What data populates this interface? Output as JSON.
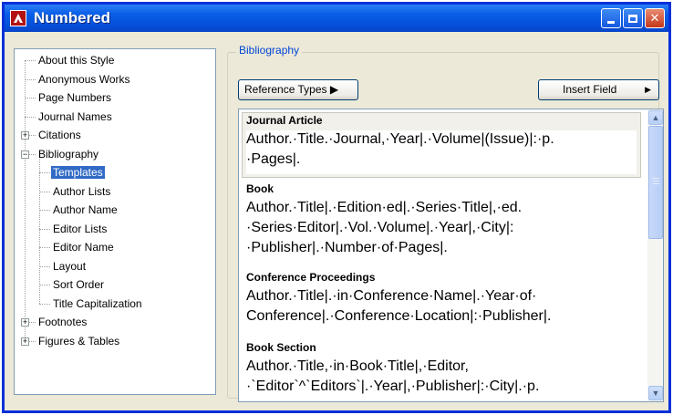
{
  "window": {
    "title": "Numbered"
  },
  "tree": {
    "items": [
      {
        "label": "About this Style",
        "level": 0,
        "expander": ""
      },
      {
        "label": "Anonymous Works",
        "level": 0,
        "expander": ""
      },
      {
        "label": "Page Numbers",
        "level": 0,
        "expander": ""
      },
      {
        "label": "Journal Names",
        "level": 0,
        "expander": ""
      },
      {
        "label": "Citations",
        "level": 0,
        "expander": "+"
      },
      {
        "label": "Bibliography",
        "level": 0,
        "expander": "-"
      },
      {
        "label": "Templates",
        "level": 1,
        "expander": "",
        "selected": true
      },
      {
        "label": "Author Lists",
        "level": 1,
        "expander": ""
      },
      {
        "label": "Author Name",
        "level": 1,
        "expander": ""
      },
      {
        "label": "Editor Lists",
        "level": 1,
        "expander": ""
      },
      {
        "label": "Editor Name",
        "level": 1,
        "expander": ""
      },
      {
        "label": "Layout",
        "level": 1,
        "expander": ""
      },
      {
        "label": "Sort Order",
        "level": 1,
        "expander": ""
      },
      {
        "label": "Title Capitalization",
        "level": 1,
        "expander": ""
      },
      {
        "label": "Footnotes",
        "level": 0,
        "expander": "+"
      },
      {
        "label": "Figures & Tables",
        "level": 0,
        "expander": "+"
      }
    ]
  },
  "panel": {
    "group_label": "Bibliography",
    "reference_types_button": "Reference Types ▶",
    "insert_field_button": "Insert Field",
    "insert_field_arrow": "▶"
  },
  "entries": [
    {
      "head": "Journal Article",
      "lines": [
        "Author.·Title.·Journal,·Year|.·Volume|(Issue)|:·p.",
        "·Pages|."
      ]
    },
    {
      "head": "Book",
      "lines": [
        "Author.·Title|.·Edition·ed|.·Series·Title|,·ed.",
        "·Series·Editor|.·Vol.·Volume|.·Year|,·City|:",
        "·Publisher|.·Number·of·Pages|."
      ]
    },
    {
      "head": "Conference Proceedings",
      "lines": [
        "Author.·Title|.·in·Conference·Name|.·Year·of·",
        "Conference|.·Conference·Location|:·Publisher|."
      ]
    },
    {
      "head": "Book Section",
      "lines": [
        "Author.·Title,·in·Book·Title|,·Editor,",
        "·`Editor`^`Editors`|.·Year|,·Publisher|:·City|.·p."
      ]
    }
  ],
  "colors": {
    "titlebar": "#0a5ee7",
    "selection": "#316ac5",
    "group_label": "#0046d5",
    "window_bg": "#ece9d8"
  },
  "icons": {
    "app": "app-logo-icon",
    "minimize": "minimize-icon",
    "maximize": "maximize-icon",
    "close": "close-icon"
  }
}
